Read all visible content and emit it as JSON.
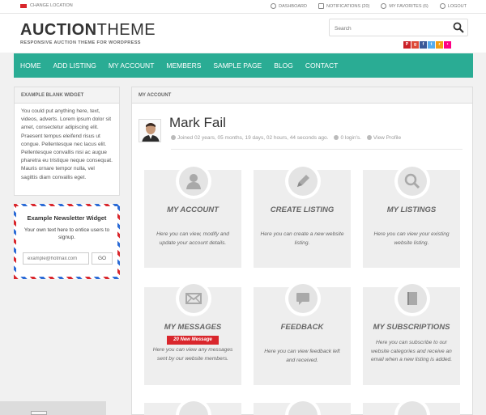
{
  "topbar": {
    "change_location": "CHANGE LOCATION",
    "links": [
      {
        "label": "DASHBOARD",
        "icon": "dashboard-icon"
      },
      {
        "label": "NOTIFICATIONS (20)",
        "icon": "envelope-icon"
      },
      {
        "label": "MY FAVORITES (6)",
        "icon": "heart-icon"
      },
      {
        "label": "LOGOUT",
        "icon": "power-icon"
      }
    ]
  },
  "header": {
    "logo_bold": "AUCTION",
    "logo_light": "THEME",
    "tagline": "RESPONSIVE AUCTION THEME FOR WORDPRESS",
    "search_placeholder": "Search",
    "social": [
      "pinterest",
      "google-plus",
      "facebook",
      "twitter",
      "rss",
      "flickr"
    ]
  },
  "nav": [
    "HOME",
    "ADD LISTING",
    "MY ACCOUNT",
    "MEMBERS",
    "SAMPLE PAGE",
    "BLOG",
    "CONTACT"
  ],
  "sidebar": {
    "widget_title": "EXAMPLE BLANK WIDGET",
    "widget_text": "You could put anything here, text, videos, adverts. Lorem ipsum dolor sit amet, consectetur adipiscing elit. Praesent tempus eleifend risus ut congue. Pellentesque nec lacus elit. Pellentesque convallis nisi ac augue pharetra eu tristique neque consequat. Mauris ornare tempor nulla, vel sagittis diam convallis eget.",
    "newsletter_title": "Example Newsletter Widget",
    "newsletter_text": "Your own text here to entice users to signup.",
    "newsletter_placeholder": "example@hotmail.com",
    "newsletter_button": "GO"
  },
  "main": {
    "title": "MY ACCOUNT",
    "user_name": "Mark Fail",
    "joined": "Joined 02 years, 05 months, 19 days, 02 hours, 44 seconds ago.",
    "logins": "0 login's.",
    "view_profile": "View Profile",
    "tiles": [
      {
        "title": "MY ACCOUNT",
        "desc": "Here you can view, modify and update your account details.",
        "icon": "user-icon"
      },
      {
        "title": "CREATE LISTING",
        "desc": "Here you can create a new website listing.",
        "icon": "pencil-icon"
      },
      {
        "title": "MY LISTINGS",
        "desc": "Here you can view your existing website listing.",
        "icon": "magnifier-icon"
      },
      {
        "title": "MY MESSAGES",
        "desc": "Here you can view any messages sent by our website members.",
        "icon": "envelope-icon",
        "badge": "20 New Message"
      },
      {
        "title": "FEEDBACK",
        "desc": "Here you can view feedback left and received.",
        "icon": "speech-bubble-icon"
      },
      {
        "title": "MY SUBSCRIPTIONS",
        "desc": "Here you can subscribe to our website categories and receive an email when a new listing is added.",
        "icon": "book-icon"
      }
    ]
  },
  "colors": {
    "nav": "#2aac94",
    "badge": "#d9262c",
    "tile": "#eeeeee"
  }
}
